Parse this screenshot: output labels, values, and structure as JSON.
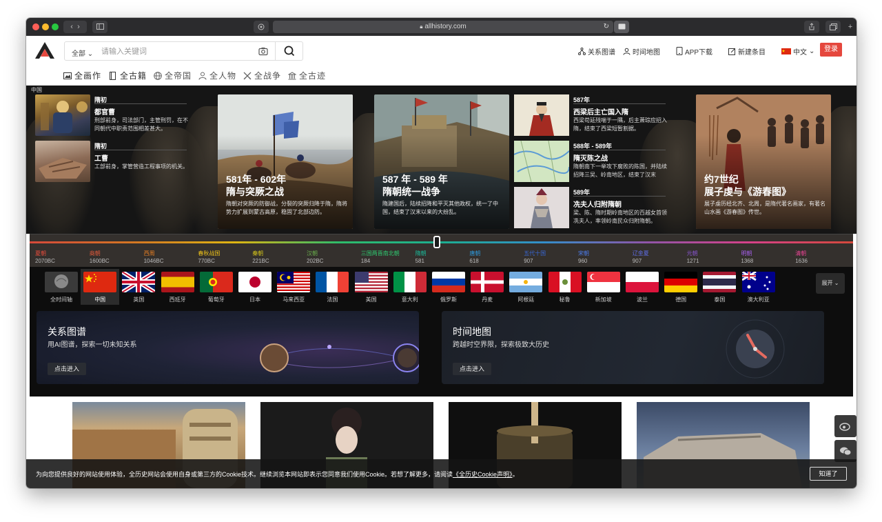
{
  "browser": {
    "url": "allhistory.com"
  },
  "header": {
    "search": {
      "scope_label": "全部",
      "placeholder": "请输入关键词"
    },
    "nav": {
      "relation_graph": "关系图谱",
      "time_map": "时间地图",
      "app_download": "APP下载",
      "new_entry": "新建条目",
      "language": "中文",
      "login": "登录"
    },
    "categories": [
      "全画作",
      "全古籍",
      "全帝国",
      "全人物",
      "全战争",
      "全古迹"
    ]
  },
  "hero": {
    "region": "中国",
    "small_cards": [
      {
        "when": "隋初",
        "name": "都官曹",
        "desc": "刑部前身，司法部门，主管刑罚，在不同朝代中职责范围相差甚大。"
      },
      {
        "when": "隋初",
        "name": "工曹",
        "desc": "工部前身，掌管营造工程事项的机关。"
      },
      {
        "when": "587年",
        "name": "西梁后主亡国入隋",
        "desc": "西梁苟延残喘于一隅，后主萧琮应招入隋，结束了西梁短暂割据。"
      },
      {
        "when": "588年 - 589年",
        "name": "隋灭陈之战",
        "desc": "隋朝南下一举攻下腐败的陈国，并陆续招降三吴、岭南地区，结束了汉末"
      },
      {
        "when": "589年",
        "name": "冼夫人归附隋朝",
        "desc": "梁、陈、隋时期岭南地区的百越女首领冼夫人，率领岭南民众归附隋朝。"
      }
    ],
    "big_cards": [
      {
        "date": "581年 - 602年",
        "title": "隋与突厥之战",
        "desc": "隋朝对突厥的防御战，分裂的突厥归降于隋，隋将势力扩展到蒙古高原，稳固了北部边防。"
      },
      {
        "date": "587 年 - 589 年",
        "title": "隋朝统一战争",
        "desc": "隋建国后，陆续招降和平灭其他政权，统一了中国，结束了汉末以来的大纷乱。"
      },
      {
        "date": "约7世纪",
        "title": "展子虔与《游春图》",
        "desc": "展子虔历经北齐、北周，是隋代著名画家，有著名山水画《游春图》传世。"
      }
    ]
  },
  "timeline": [
    {
      "era": "夏朝",
      "year": "2070BC",
      "color": "#e74c3c"
    },
    {
      "era": "商朝",
      "year": "1600BC",
      "color": "#e55a3a"
    },
    {
      "era": "西周",
      "year": "1046BC",
      "color": "#e67e22"
    },
    {
      "era": "春秋战国",
      "year": "770BC",
      "color": "#f0c419"
    },
    {
      "era": "秦朝",
      "year": "221BC",
      "color": "#d4c41a"
    },
    {
      "era": "汉朝",
      "year": "202BC",
      "color": "#6ab04c"
    },
    {
      "era": "三国两晋南北朝",
      "year": "184",
      "color": "#2ecc71"
    },
    {
      "era": "隋朝",
      "year": "581",
      "color": "#1abc9c"
    },
    {
      "era": "唐朝",
      "year": "618",
      "color": "#2d98da"
    },
    {
      "era": "五代十国",
      "year": "907",
      "color": "#3867d6"
    },
    {
      "era": "宋朝",
      "year": "960",
      "color": "#4b7bec"
    },
    {
      "era": "辽金夏",
      "year": "907",
      "color": "#5f6ee8"
    },
    {
      "era": "元朝",
      "year": "1271",
      "color": "#8854d0"
    },
    {
      "era": "明朝",
      "year": "1368",
      "color": "#a55eea"
    },
    {
      "era": "清朝",
      "year": "1636",
      "color": "#e84393"
    }
  ],
  "countries": [
    "全时间轴",
    "中国",
    "英国",
    "西班牙",
    "葡萄牙",
    "日本",
    "马来西亚",
    "法国",
    "美国",
    "意大利",
    "俄罗斯",
    "丹麦",
    "阿根廷",
    "秘鲁",
    "新加坡",
    "波兰",
    "德国",
    "泰国",
    "澳大利亚"
  ],
  "expand_label": "展开",
  "features": [
    {
      "title": "关系图谱",
      "subtitle": "用AI图谱，探索一切未知关系",
      "enter": "点击进入"
    },
    {
      "title": "时间地图",
      "subtitle": "跨越时空界限，探索极致大历史",
      "enter": "点击进入"
    }
  ],
  "cookie": {
    "text": "为向您提供良好的网站使用体验，全历史网站会使用自身或第三方的Cookie技术。继续浏览本网站即表示您同意我们使用Cookie。若想了解更多，请阅读",
    "link": "《全历史Cookie声明》",
    "tail": "。",
    "ok": "知道了"
  }
}
